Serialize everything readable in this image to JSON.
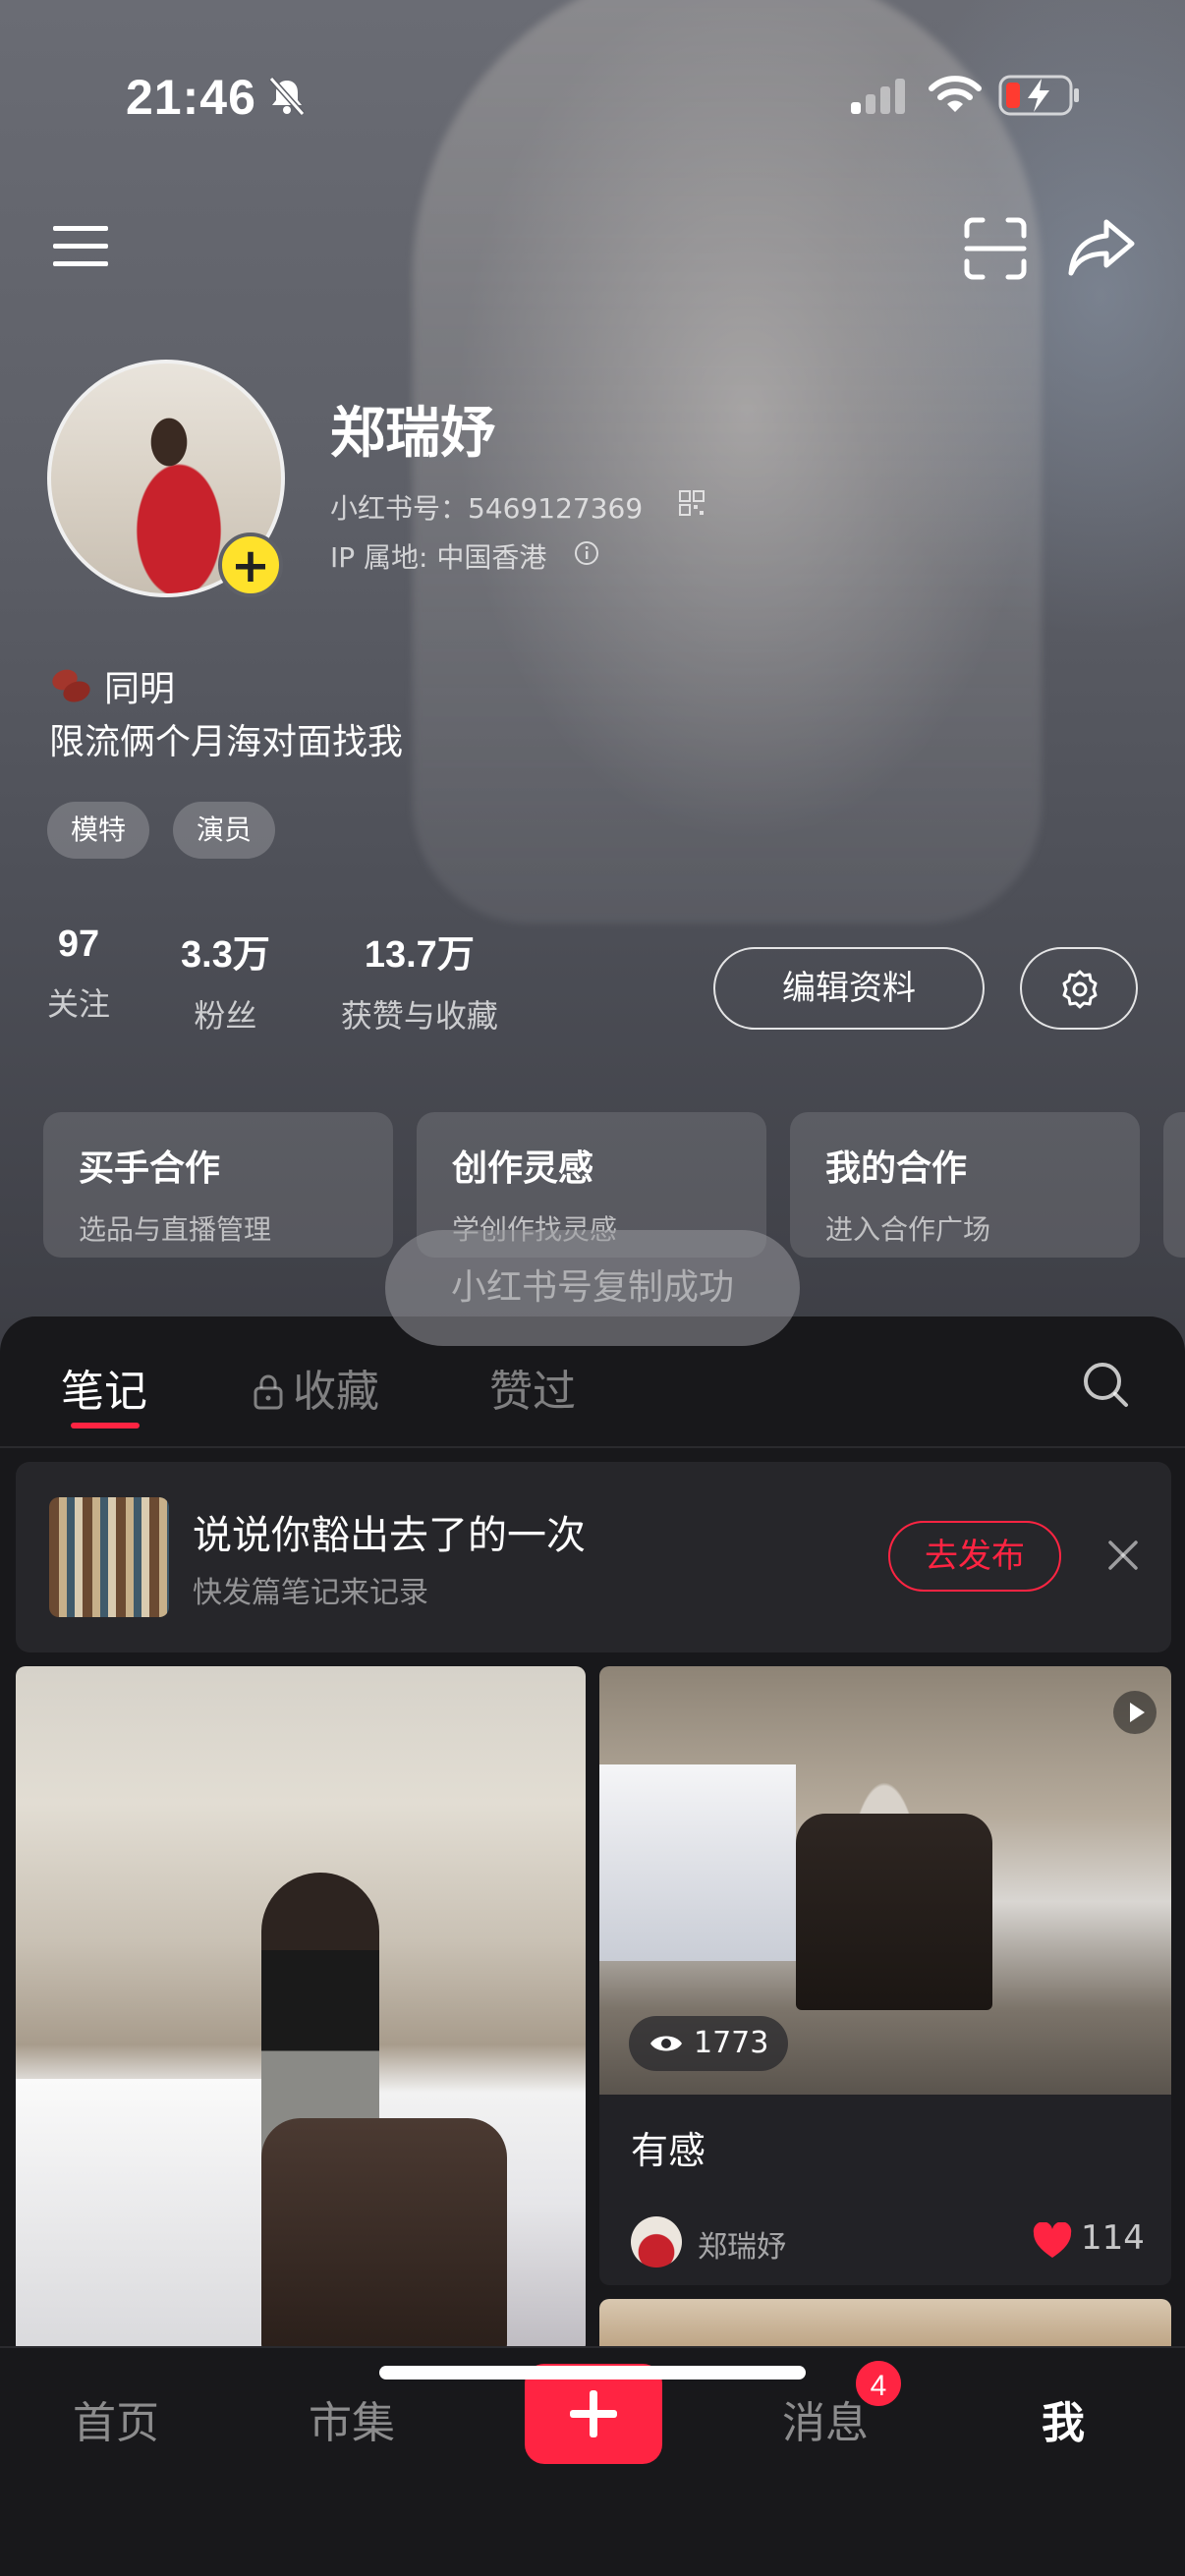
{
  "status_bar": {
    "time": "21:46"
  },
  "profile": {
    "name": "郑瑞妤",
    "id_text": "小红书号：5469127369",
    "ip_text": "IP 属地: 中国香港",
    "school": "同明",
    "bio": "限流俩个月海对面找我",
    "tags": [
      "模特",
      "演员"
    ],
    "stats": [
      {
        "num": "97",
        "label": "关注"
      },
      {
        "num": "3.3万",
        "label": "粉丝"
      },
      {
        "num": "13.7万",
        "label": "获赞与收藏"
      }
    ],
    "edit_label": "编辑资料"
  },
  "cards": [
    {
      "title": "买手合作",
      "sub": "选品与直播管理"
    },
    {
      "title": "创作灵感",
      "sub": "学创作找灵感"
    },
    {
      "title": "我的合作",
      "sub": "进入合作广场"
    }
  ],
  "toast": "小红书号复制成功",
  "tabs": {
    "notes": "笔记",
    "collections": "收藏",
    "liked": "赞过"
  },
  "prompt": {
    "title": "说说你豁出去了的一次",
    "sub": "快发篇笔记来记录",
    "button": "去发布"
  },
  "notes": [
    {
      "views": "1773",
      "title": "有感",
      "author": "郑瑞妤",
      "likes": "114"
    }
  ],
  "bottom_nav": {
    "home": "首页",
    "market": "市集",
    "messages": "消息",
    "messages_badge": "4",
    "me": "我"
  },
  "colors": {
    "accent": "#ff2442",
    "avatar_add": "#ffe22b"
  }
}
